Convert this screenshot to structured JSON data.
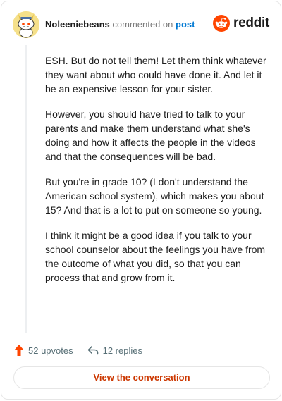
{
  "header": {
    "username": "Noleeniebeans",
    "action_text": "commented on",
    "post_link": "post",
    "brand": "reddit"
  },
  "comment": {
    "paragraphs": [
      "ESH. But do not tell them! Let them think whatever they want about who could have done it. And let it be an expensive lesson for your sister.",
      "However, you should have tried to talk to your parents and make them understand what she's doing and how it affects the people in the videos and that the consequences will be bad.",
      "But you're in grade 10? (I don't understand the American school system), which makes you about 15? And that is a lot to put on someone so young.",
      "I think it might be a good idea if you talk to your school counselor about the feelings you have from the outcome of what you did, so that you can process that and grow from it."
    ]
  },
  "footer": {
    "upvotes": "52 upvotes",
    "replies": "12 replies",
    "view_button": "View the conversation"
  },
  "colors": {
    "brand_orange": "#ff4500",
    "link_blue": "#0079d3",
    "button_text": "#cc3700",
    "muted": "#576f76"
  },
  "icons": {
    "avatar": "snoo-avatar",
    "brand_logo": "reddit-snoo-icon",
    "upvote": "upvote-arrow-icon",
    "reply": "reply-arrow-icon"
  }
}
